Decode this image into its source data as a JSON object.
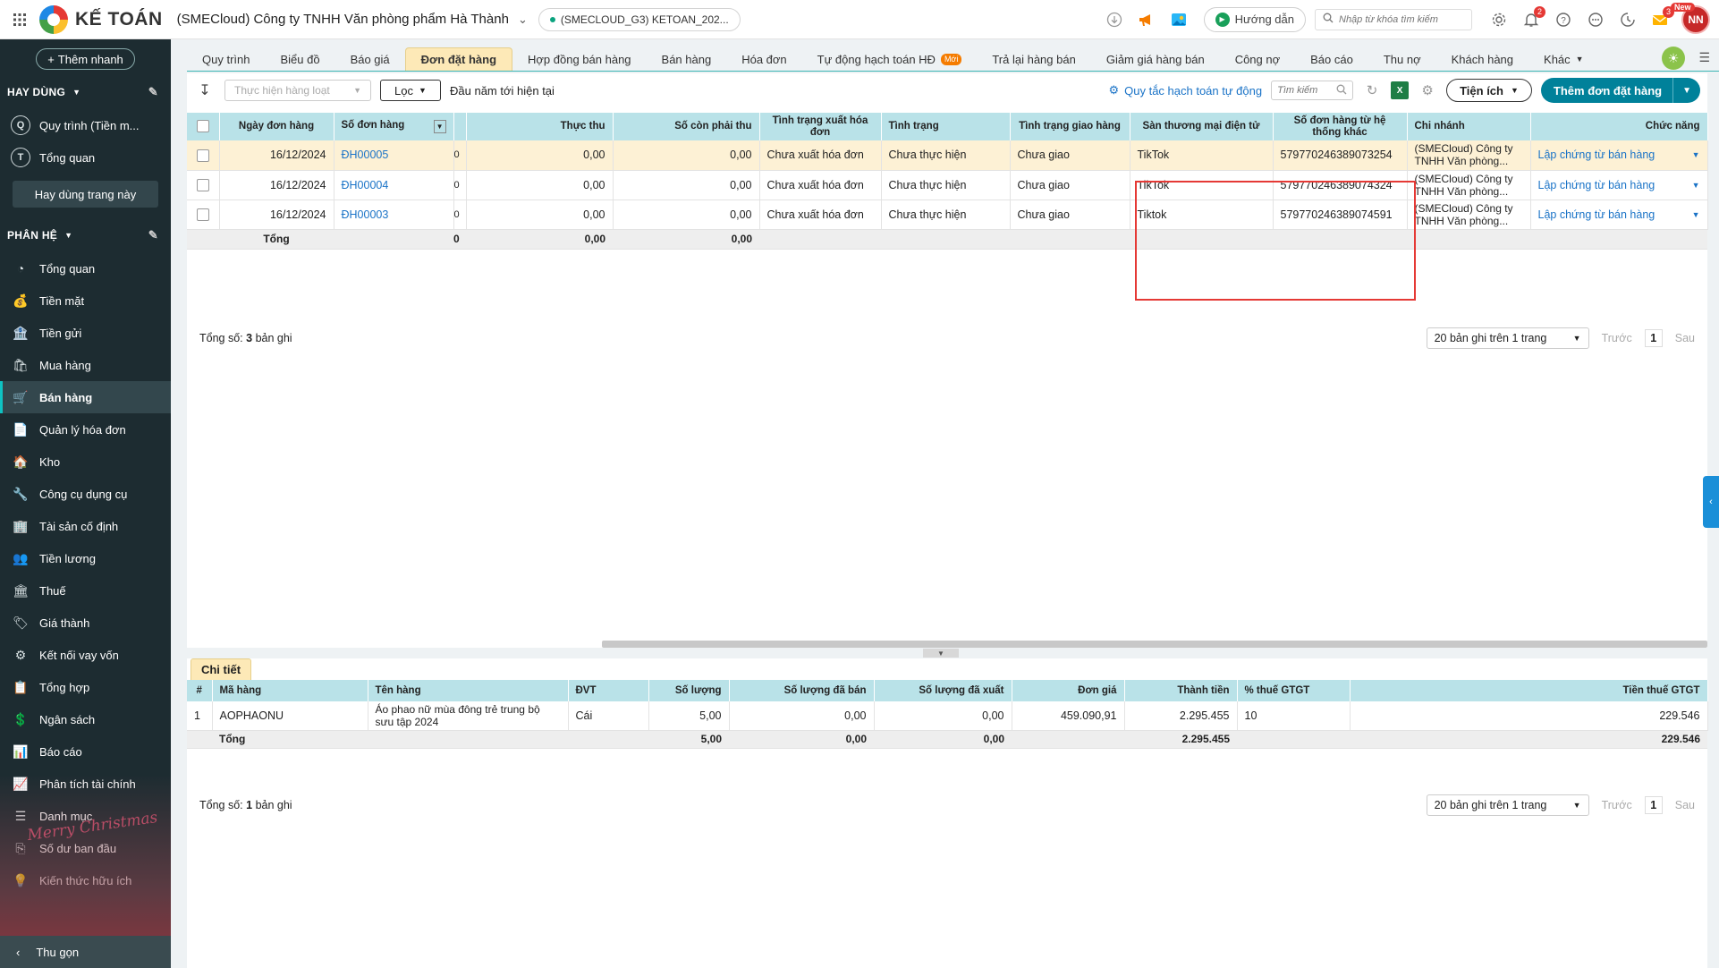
{
  "topbar": {
    "logo_text": "KẾ TOÁN",
    "company": "(SMECloud) Công ty TNHH Văn phòng phẩm Hà Thành",
    "db_name": "(SMECLOUD_G3) KETOAN_202...",
    "guide_label": "Hướng dẫn",
    "search_placeholder": "Nhập từ khóa tìm kiếm",
    "notif_count": "2",
    "msg_count": "3",
    "new_badge": "New",
    "avatar_initials": "NN"
  },
  "sidebar": {
    "quick_add": "Thêm nhanh",
    "fav_header": "HAY DÙNG",
    "fav_items": [
      {
        "letter": "Q",
        "label": "Quy trình (Tiền m..."
      },
      {
        "letter": "T",
        "label": "Tổng quan"
      }
    ],
    "fav_page_btn": "Hay dùng trang này",
    "module_header": "PHÂN HỆ",
    "modules": [
      "Tổng quan",
      "Tiền mặt",
      "Tiền gửi",
      "Mua hàng",
      "Bán hàng",
      "Quản lý hóa đơn",
      "Kho",
      "Công cụ dụng cụ",
      "Tài sản cố định",
      "Tiền lương",
      "Thuế",
      "Giá thành",
      "Kết nối vay vốn",
      "Tổng hợp",
      "Ngân sách",
      "Báo cáo",
      "Phân tích tài chính",
      "Danh mục",
      "Số dư ban đầu",
      "Kiến thức hữu ích"
    ],
    "active_module": "Bán hàng",
    "xmas_text": "Merry Christmas",
    "collapse": "Thu gọn"
  },
  "tabs": [
    {
      "label": "Quy trình"
    },
    {
      "label": "Biểu đồ"
    },
    {
      "label": "Báo giá"
    },
    {
      "label": "Đơn đặt hàng"
    },
    {
      "label": "Hợp đồng bán hàng"
    },
    {
      "label": "Bán hàng"
    },
    {
      "label": "Hóa đơn"
    },
    {
      "label": "Tự động hạch toán HĐ",
      "badge": "Mới"
    },
    {
      "label": "Trả lại hàng bán"
    },
    {
      "label": "Giảm giá hàng bán"
    },
    {
      "label": "Công nợ"
    },
    {
      "label": "Báo cáo"
    },
    {
      "label": "Thu nợ"
    },
    {
      "label": "Khách hàng"
    },
    {
      "label": "Khác"
    }
  ],
  "active_tab": "Đơn đặt hàng",
  "toolbar": {
    "batch_action": "Thực hiện hàng loạt",
    "filter": "Lọc",
    "period": "Đầu năm tới hiện tại",
    "rule_link": "Quy tắc hạch toán tự động",
    "search_placeholder": "Tìm kiếm",
    "utility": "Tiện ích",
    "add_order": "Thêm đơn đặt hàng"
  },
  "orders": {
    "columns": [
      "Ngày đơn hàng",
      "Số đơn hàng",
      "Thực thu",
      "Số còn phải thu",
      "Tình trạng xuất hóa đơn",
      "Tình trạng",
      "Tình trạng giao hàng",
      "Sàn thương mại điện tử",
      "Số đơn hàng từ hệ thống khác",
      "Chi nhánh",
      "Chức năng"
    ],
    "rows": [
      {
        "date": "16/12/2024",
        "no": "ĐH00005",
        "cut": "0",
        "paid": "0,00",
        "remain": "0,00",
        "invoice": "Chưa xuất hóa đơn",
        "status": "Chưa thực hiện",
        "delivery": "Chưa giao",
        "ecom": "TikTok",
        "ext_no": "579770246389073254",
        "branch": "(SMECloud) Công ty TNHH Văn phòng...",
        "action": "Lập chứng từ bán hàng"
      },
      {
        "date": "16/12/2024",
        "no": "ĐH00004",
        "cut": "0",
        "paid": "0,00",
        "remain": "0,00",
        "invoice": "Chưa xuất hóa đơn",
        "status": "Chưa thực hiện",
        "delivery": "Chưa giao",
        "ecom": "TikTok",
        "ext_no": "579770246389074324",
        "branch": "(SMECloud) Công ty TNHH Văn phòng...",
        "action": "Lập chứng từ bán hàng"
      },
      {
        "date": "16/12/2024",
        "no": "ĐH00003",
        "cut": "0",
        "paid": "0,00",
        "remain": "0,00",
        "invoice": "Chưa xuất hóa đơn",
        "status": "Chưa thực hiện",
        "delivery": "Chưa giao",
        "ecom": "Tiktok",
        "ext_no": "579770246389074591",
        "branch": "(SMECloud) Công ty TNHH Văn phòng...",
        "action": "Lập chứng từ bán hàng"
      }
    ],
    "total_label": "Tổng",
    "total_cut": "0",
    "total_paid": "0,00",
    "total_remain": "0,00",
    "record_prefix": "Tổng số:",
    "record_count": "3",
    "record_suffix": "bản ghi",
    "page_size": "20 bản ghi trên 1 trang",
    "prev": "Trước",
    "page": "1",
    "next": "Sau"
  },
  "detail": {
    "tab": "Chi tiết",
    "columns": [
      "#",
      "Mã hàng",
      "Tên hàng",
      "ĐVT",
      "Số lượng",
      "Số lượng đã bán",
      "Số lượng đã xuất",
      "Đơn giá",
      "Thành tiền",
      "% thuế GTGT",
      "Tiền thuế GTGT"
    ],
    "rows": [
      {
        "idx": "1",
        "code": "AOPHAONU",
        "name": "Áo phao nữ mùa đông trẻ trung bộ sưu tập 2024",
        "unit": "Cái",
        "qty": "5,00",
        "sold": "0,00",
        "issued": "0,00",
        "price": "459.090,91",
        "amount": "2.295.455",
        "vat_rate": "10",
        "vat": "229.546"
      }
    ],
    "total_label": "Tổng",
    "total_qty": "5,00",
    "total_sold": "0,00",
    "total_issued": "0,00",
    "total_amount": "2.295.455",
    "total_vat": "229.546",
    "record_prefix": "Tổng số:",
    "record_count": "1",
    "record_suffix": "bản ghi",
    "page_size": "20 bản ghi trên 1 trang",
    "prev": "Trước",
    "page": "1",
    "next": "Sau"
  }
}
